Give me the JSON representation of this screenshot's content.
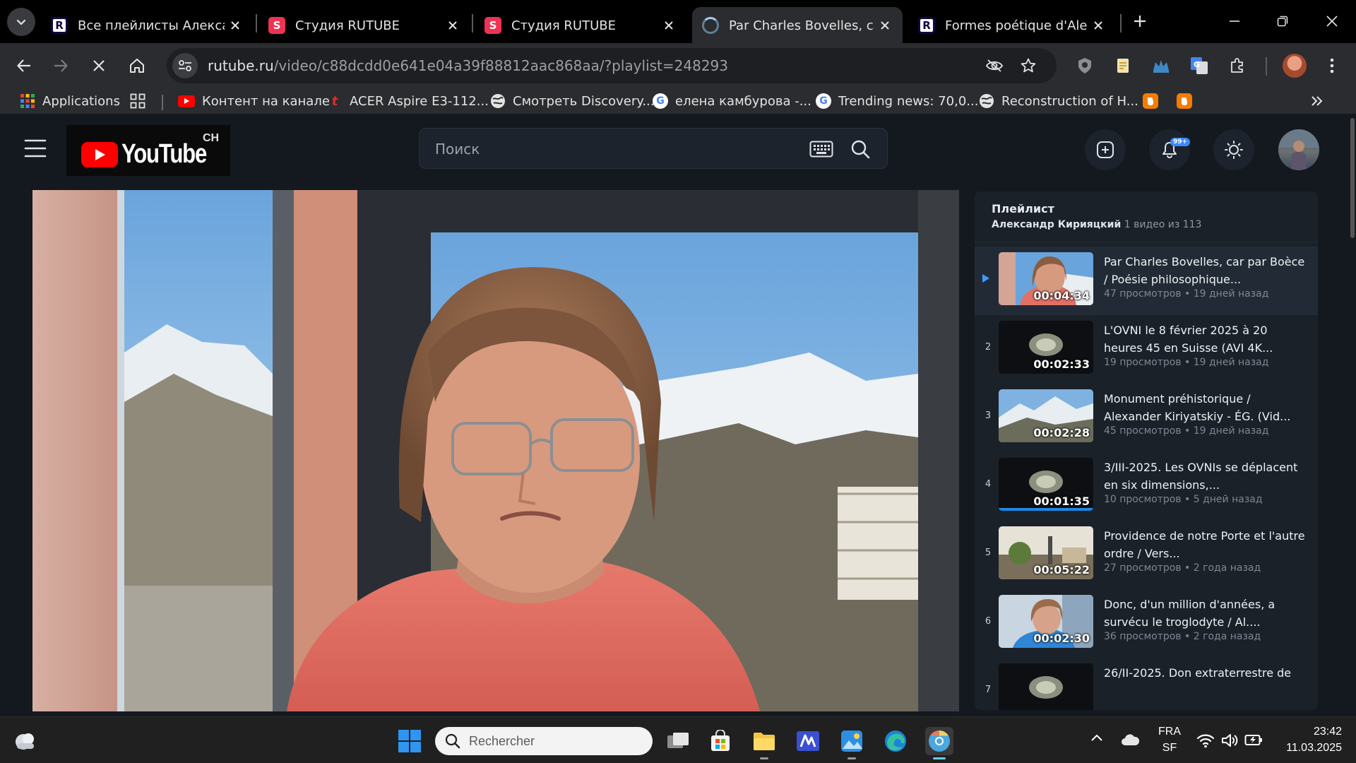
{
  "tabs": [
    {
      "title": "Все плейлисты Александ",
      "favicon": "rutube",
      "active": false
    },
    {
      "title": "Студия RUTUBE",
      "favicon": "studio",
      "active": false
    },
    {
      "title": "Студия RUTUBE",
      "favicon": "studio",
      "active": false
    },
    {
      "title": "Par Charles Bovelles, car p",
      "favicon": "loading",
      "active": true
    },
    {
      "title": "Formes poétique d'Alexa",
      "favicon": "rutube",
      "active": false
    }
  ],
  "address": {
    "host": "rutube.ru",
    "path": "/video/c88dcdd0e641e04a39f88812aac868aa/?playlist=248293"
  },
  "bookmarks": [
    {
      "label": "Applications",
      "icon": "apps-grid-icon"
    },
    {
      "label": "Контент на канале",
      "icon": "youtube-icon"
    },
    {
      "label": "ACER Aspire E3-112...",
      "icon": "acer-icon"
    },
    {
      "label": "Смотреть Discovery...",
      "icon": "globe-icon"
    },
    {
      "label": "елена камбурова -...",
      "icon": "google-icon"
    },
    {
      "label": "Trending news: 70,0...",
      "icon": "google-icon"
    },
    {
      "label": "Reconstruction of H...",
      "icon": "globe-icon"
    }
  ],
  "page": {
    "logo_text": "YouTube",
    "logo_region": "CH",
    "search_placeholder": "Поиск",
    "notification_badge": "99+"
  },
  "playlist": {
    "heading": "Плейлист",
    "owner": "Александр Кирияцкий",
    "position_text": "1 видео из 113",
    "items": [
      {
        "index": "",
        "duration": "00:04:34",
        "title": "Par Charles Bovelles, car par Boèce / Poésie philosophique...",
        "views": "47 просмотров",
        "age": "19 дней назад",
        "active": true,
        "thumb": "person"
      },
      {
        "index": "2",
        "duration": "00:02:33",
        "title": "L'OVNI le 8 février 2025 à 20 heures 45 en Suisse (AVI 4K...",
        "views": "19 просмотров",
        "age": "19 дней назад",
        "active": false,
        "thumb": "glow"
      },
      {
        "index": "3",
        "duration": "00:02:28",
        "title": "Monument préhistorique / Alexander Kiriyatskiy - ÉG. (Vid...",
        "views": "45 просмотров",
        "age": "19 дней назад",
        "active": false,
        "thumb": "mountain"
      },
      {
        "index": "4",
        "duration": "00:01:35",
        "title": "3/III-2025. Les OVNIs se déplacent en six dimensions,...",
        "views": "10 просмотров",
        "age": "5 дней назад",
        "active": false,
        "thumb": "glow",
        "progress": 1.0
      },
      {
        "index": "5",
        "duration": "00:05:22",
        "title": "Providence de notre Porte et l'autre ordre / Vers...",
        "views": "27 просмотров",
        "age": "2 года назад",
        "active": false,
        "thumb": "street"
      },
      {
        "index": "6",
        "duration": "00:02:30",
        "title": "Donc, d'un million d'années, a survécu le troglodyte / Al....",
        "views": "36 просмотров",
        "age": "2 года назад",
        "active": false,
        "thumb": "person-blue"
      },
      {
        "index": "7",
        "duration": "",
        "title": "26/II-2025. Don extraterrestre de",
        "views": "",
        "age": "",
        "active": false,
        "thumb": "glow"
      }
    ]
  },
  "taskbar": {
    "search_placeholder": "Rechercher",
    "lang_top": "FRA",
    "lang_bottom": "SF",
    "time": "23:42",
    "date": "11.03.2025"
  },
  "colors": {
    "accent_blue": "#1e88e5",
    "youtube_red": "#ff0000",
    "studio_red": "#ee3355",
    "page_bg": "#14191f",
    "playlist_bg": "#1a2129"
  }
}
